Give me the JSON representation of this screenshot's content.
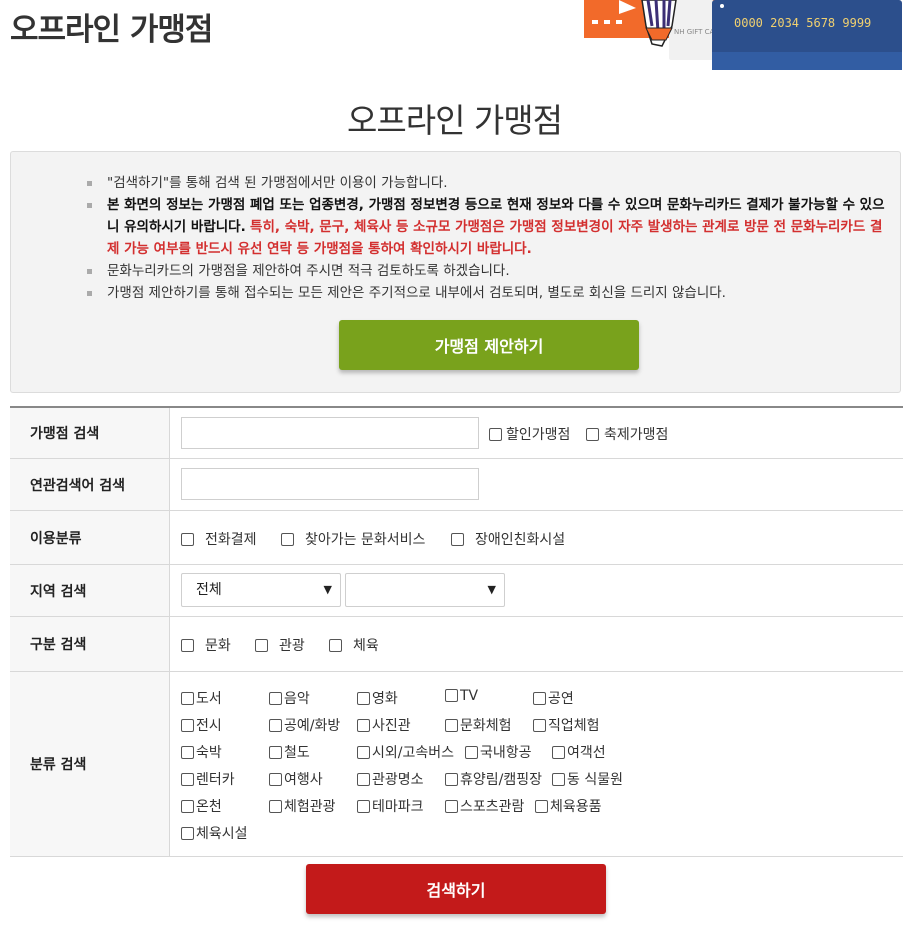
{
  "header": {
    "title": "오프라인 가맹점"
  },
  "banner": {
    "card_number": "0000 2034 5678 9999",
    "gift_text": "NH GIFT CA"
  },
  "page_title": "오프라인 가맹점",
  "notice": {
    "item1": "\"검색하기\"를 통해 검색 된 가맹점에서만 이용이 가능합니다.",
    "item2_bold": "본 화면의 정보는 가맹점 폐업 또는 업종변경, 가맹점 정보변경 등으로 현재 정보와 다를 수 있으며 문화누리카드 결제가 불가능할 수 있으니 유의하시기 바랍니다.",
    "item2_red": "특히, 숙박, 문구, 체육사 등 소규모 가맹점은 가맹점 정보변경이 자주 발생하는 관계로 방문 전 문화누리카드 결제 가능 여부를 반드시 유선 연락 등 가맹점을 통하여 확인하시기 바랍니다.",
    "item3": "문화누리카드의 가맹점을 제안하여 주시면 적극 검토하도록 하겠습니다.",
    "item4": "가맹점 제안하기를 통해 접수되는 모든 제안은 주기적으로 내부에서 검토되며, 별도로 회신을 드리지 않습니다.",
    "suggest_button": "가맹점 제안하기"
  },
  "form": {
    "store_search": {
      "label": "가맹점 검색",
      "value": "",
      "opt_discount": "할인가맹점",
      "opt_festival": "축제가맹점"
    },
    "related_search": {
      "label": "연관검색어 검색",
      "value": ""
    },
    "usage": {
      "label": "이용분류",
      "opt1": "전화결제",
      "opt2": "찾아가는 문화서비스",
      "opt3": "장애인친화시설"
    },
    "region": {
      "label": "지역 검색",
      "select1": "전체",
      "select2": ""
    },
    "division": {
      "label": "구분 검색",
      "opt1": "문화",
      "opt2": "관광",
      "opt3": "체육"
    },
    "category": {
      "label": "분류 검색",
      "items": [
        "도서",
        "음악",
        "영화",
        "TV",
        "공연",
        "전시",
        "공예/화방",
        "사진관",
        "문화체험",
        "직업체험",
        "숙박",
        "철도",
        "시외/고속버스",
        "국내항공",
        "여객선",
        "렌터카",
        "여행사",
        "관광명소",
        "휴양림/캠핑장",
        "동 식물원",
        "온천",
        "체험관광",
        "테마파크",
        "스포츠관람",
        "체육용품",
        "체육시설"
      ]
    }
  },
  "search_button": "검색하기",
  "colors": {
    "suggest_green": "#79a21c",
    "search_red": "#c31a1a",
    "notice_red": "#d32f2f"
  }
}
